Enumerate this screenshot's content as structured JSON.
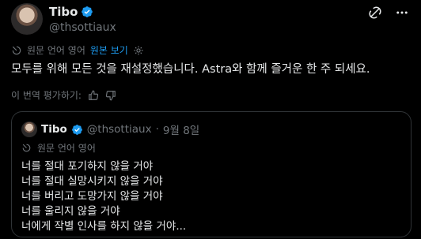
{
  "author": {
    "name": "Tibo",
    "handle": "@thsottiaux"
  },
  "translation": {
    "source_language": "원문 언어 영어",
    "show_original_link": "원본 보기"
  },
  "tweet": {
    "text": "모두를 위해 모든 것을 재설정했습니다. Astra와 함께 즐거운 한 주 되세요.",
    "rate_translation_label": "이 번역 평가하기:"
  },
  "quoted_tweet": {
    "name": "Tibo",
    "handle": "@thsottiaux",
    "separator": "·",
    "date": "9월 8일",
    "source_language": "원문 언어 영어",
    "lines": [
      "너를 절대 포기하지 않을 거야",
      "너를 절대 실망시키지 않을 거야",
      "너를 버리고 도망가지 않을 거야",
      "너를 울리지 않을 거야",
      "너에게 작별 인사를 하지 않을 거야..."
    ]
  },
  "colors": {
    "background": "#000000",
    "text": "#e7e9ea",
    "muted": "#71767b",
    "accent": "#1d9bf0",
    "border": "#2f3336"
  },
  "icons": [
    "verified-badge-icon",
    "grok-icon",
    "more-icon",
    "globe-icon",
    "gear-icon",
    "thumbs-up-icon",
    "thumbs-down-icon"
  ]
}
